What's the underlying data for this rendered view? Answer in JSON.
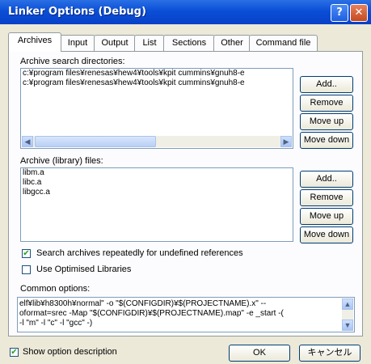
{
  "window": {
    "title": "Linker Options (Debug)"
  },
  "titlebar": {
    "help_glyph": "?",
    "close_glyph": "✕"
  },
  "tabs": [
    {
      "label": "Archives"
    },
    {
      "label": "Input"
    },
    {
      "label": "Output"
    },
    {
      "label": "List"
    },
    {
      "label": "Sections"
    },
    {
      "label": "Other"
    },
    {
      "label": "Command file"
    }
  ],
  "search_dirs": {
    "label": "Archive search directories:",
    "items": [
      "c:¥program files¥renesas¥hew4¥tools¥kpit cummins¥gnuh8-e",
      "c:¥program files¥renesas¥hew4¥tools¥kpit cummins¥gnuh8-e"
    ],
    "buttons": {
      "add": "Add..",
      "remove": "Remove",
      "move_up": "Move up",
      "move_down": "Move down"
    }
  },
  "library_files": {
    "label": "Archive (library) files:",
    "items": [
      "libm.a",
      "libc.a",
      "libgcc.a"
    ],
    "buttons": {
      "add": "Add..",
      "remove": "Remove",
      "move_up": "Move up",
      "move_down": "Move down"
    }
  },
  "options": {
    "search_repeatedly": {
      "label": "Search archives repeatedly for undefined references",
      "checked": true
    },
    "optimised_libraries": {
      "label": "Use Optimised Libraries",
      "checked": false
    }
  },
  "common_options": {
    "label": "Common options:",
    "text": "elf¥lib¥h8300h¥normal\" -o \"$(CONFIGDIR)¥$(PROJECTNAME).x\" --\noformat=srec -Map \"$(CONFIGDIR)¥$(PROJECTNAME).map\" -e _start -(\n-l \"m\" -l \"c\" -l \"gcc\" -)"
  },
  "footer": {
    "show_description": {
      "label": "Show option description",
      "checked": true
    },
    "ok": "OK",
    "cancel": "キャンセル"
  }
}
